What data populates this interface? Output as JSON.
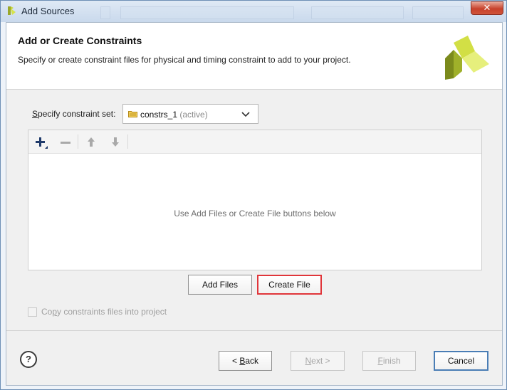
{
  "window": {
    "title": "Add Sources",
    "close_glyph": "✕"
  },
  "header": {
    "title": "Add or Create Constraints",
    "subtitle": "Specify or create constraint files for physical and timing constraint to add to your project.",
    "logo_icon": "vivado-logo-icon"
  },
  "constraint_set": {
    "label_prefix": "",
    "label_mnemonic": "S",
    "label_rest": "pecify constraint set:",
    "selected_name": "constrs_1",
    "selected_suffix": "(active)"
  },
  "toolbar": {
    "add_icon": "plus-icon",
    "remove_icon": "minus-icon",
    "up_icon": "arrow-up-icon",
    "down_icon": "arrow-down-icon"
  },
  "files_panel": {
    "empty_message": "Use Add Files or Create File buttons below"
  },
  "actions": {
    "add_files_label": "Add Files",
    "create_file_label": "Create File"
  },
  "copy_option": {
    "label_prefix": "Co",
    "label_mnemonic": "p",
    "label_rest": "y constraints files into project",
    "checked": false
  },
  "footer": {
    "help_glyph": "?",
    "back_prefix": "< ",
    "back_mnemonic": "B",
    "back_rest": "ack",
    "next_mnemonic": "N",
    "next_rest": "ext >",
    "finish_mnemonic": "F",
    "finish_rest": "inish",
    "cancel_label": "Cancel"
  },
  "colors": {
    "accent_highlight": "#e0353a",
    "primary_border": "#4a7db5",
    "logo_light": "#d6e34a",
    "logo_dark": "#7b8a1c"
  }
}
